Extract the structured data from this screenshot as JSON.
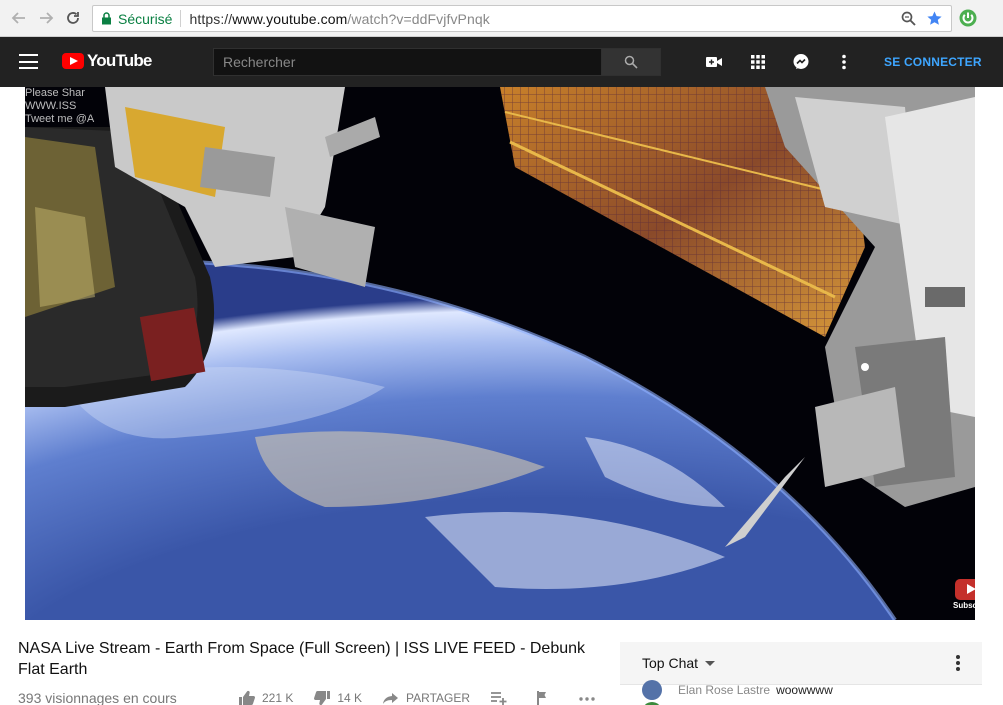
{
  "browser": {
    "secure_label": "Sécurisé",
    "url_scheme": "https://",
    "url_host": "www.youtube.com",
    "url_path": "/watch?v=ddFvjfvPnqk"
  },
  "header": {
    "logo_text": "YouTube",
    "search_placeholder": "Rechercher",
    "signin_label": "SE CONNECTER"
  },
  "player": {
    "overlay_lines": [
      "Please Shar",
      "WWW.ISS",
      "Tweet me @A"
    ],
    "subscribe_label": "Subscribe"
  },
  "video": {
    "title": "NASA Live Stream - Earth From Space (Full Screen) | ISS LIVE FEED - Debunk Flat Earth",
    "views": "393 visionnages en cours",
    "likes": "221 K",
    "dislikes": "14 K",
    "share_label": "PARTAGER"
  },
  "chat": {
    "title": "Top Chat",
    "first_author": "Elan Rose Lastre",
    "first_message": "woowwww"
  },
  "colors": {
    "brand_red": "#ff0000",
    "secure_green": "#0b8043",
    "signin_blue": "#3ea6ff"
  }
}
